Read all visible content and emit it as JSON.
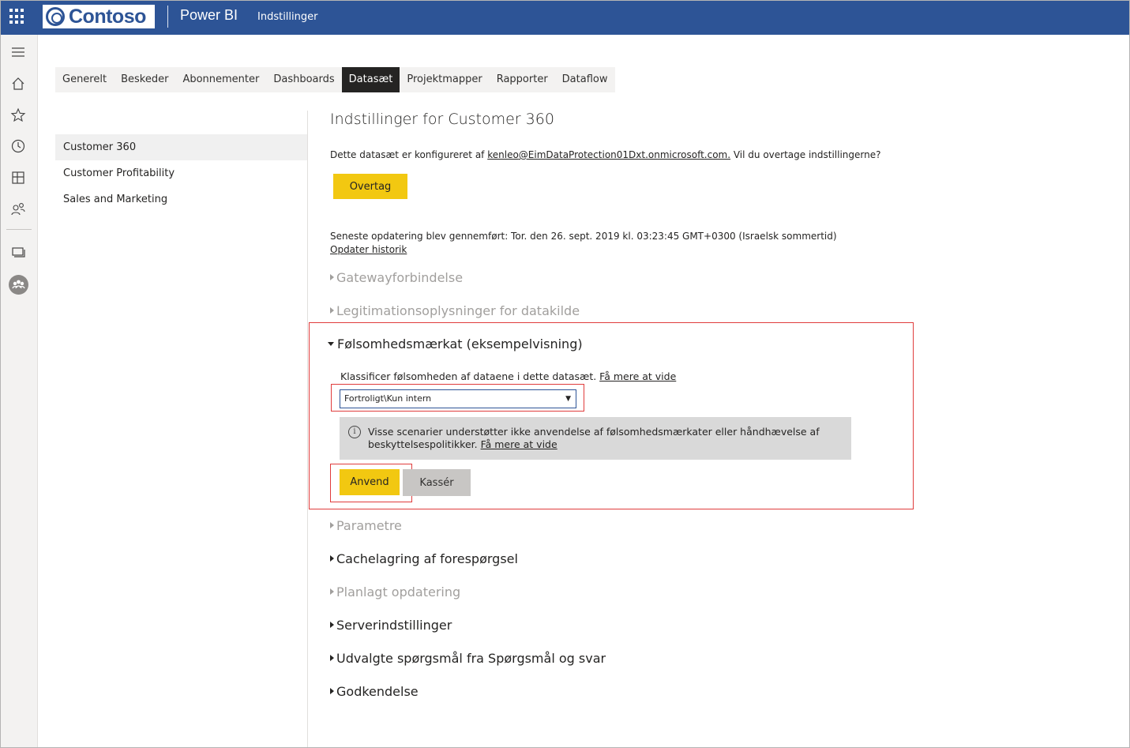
{
  "header": {
    "logo_text": "Contoso",
    "app_name": "Power BI",
    "page_name": "Indstillinger"
  },
  "leftnav": {
    "icons": [
      "menu-icon",
      "home-icon",
      "favorites-star-icon",
      "recent-clock-icon",
      "apps-icon",
      "shared-with-me-icon",
      "workspaces-icon",
      "workspace-avatar-icon"
    ]
  },
  "tabs": [
    {
      "label": "Generelt",
      "active": false
    },
    {
      "label": "Beskeder",
      "active": false
    },
    {
      "label": "Abonnementer",
      "active": false
    },
    {
      "label": "Dashboards",
      "active": false
    },
    {
      "label": "Datasæt",
      "active": true
    },
    {
      "label": "Projektmapper",
      "active": false
    },
    {
      "label": "Rapporter",
      "active": false
    },
    {
      "label": "Dataflow",
      "active": false
    }
  ],
  "datasets": [
    {
      "label": "Customer 360",
      "selected": true
    },
    {
      "label": "Customer Profitability",
      "selected": false
    },
    {
      "label": "Sales and Marketing",
      "selected": false
    }
  ],
  "main": {
    "title": "Indstillinger for Customer 360",
    "takeover_prefix": "Dette datasæt er konfigureret af ",
    "takeover_user": "kenleo",
    "takeover_domain": "@EimDataProtection01Dxt.onmicrosoft.com.",
    "takeover_suffix": " Vil du overtage indstillingerne?",
    "takeover_button": "Overtag",
    "last_refresh": "Seneste opdatering blev gennemført: Tor. den 26. sept. 2019 kl. 03:23:45 GMT+0300 (Israelsk sommertid)",
    "refresh_history_link": "Opdater historik"
  },
  "sections": {
    "gateway": "Gatewayforbindelse",
    "credentials": "Legitimationsoplysninger for datakilde",
    "sensitivity": "Følsomhedsmærkat (eksempelvisning)",
    "parameters": "Parametre",
    "query_caching": "Cachelagring af forespørgsel",
    "scheduled_refresh": "Planlagt opdatering",
    "server_settings": "Serverindstillinger",
    "featured_qa": "Udvalgte spørgsmål fra Spørgsmål og svar",
    "endorsement": "Godkendelse"
  },
  "sensitivity": {
    "classify_text": "Klassificer følsomheden af dataene i dette datasæt. ",
    "learn_more": "Få mere at vide",
    "selected_label": "Fortroligt\\Kun intern",
    "dropdown_arrow": "▼",
    "info_icon": "i",
    "info_text": "Visse scenarier understøtter ikke anvendelse af følsomhedsmærkater eller håndhævelse af beskyttelsespolitikker. ",
    "info_learn_more": "Få mere at vide",
    "apply_button": "Anvend",
    "discard_button": "Kassér"
  },
  "colors": {
    "topbar": "#2d5496",
    "accent_yellow": "#f2c811",
    "highlight_red": "#e03c3c",
    "active_tab": "#252423"
  }
}
